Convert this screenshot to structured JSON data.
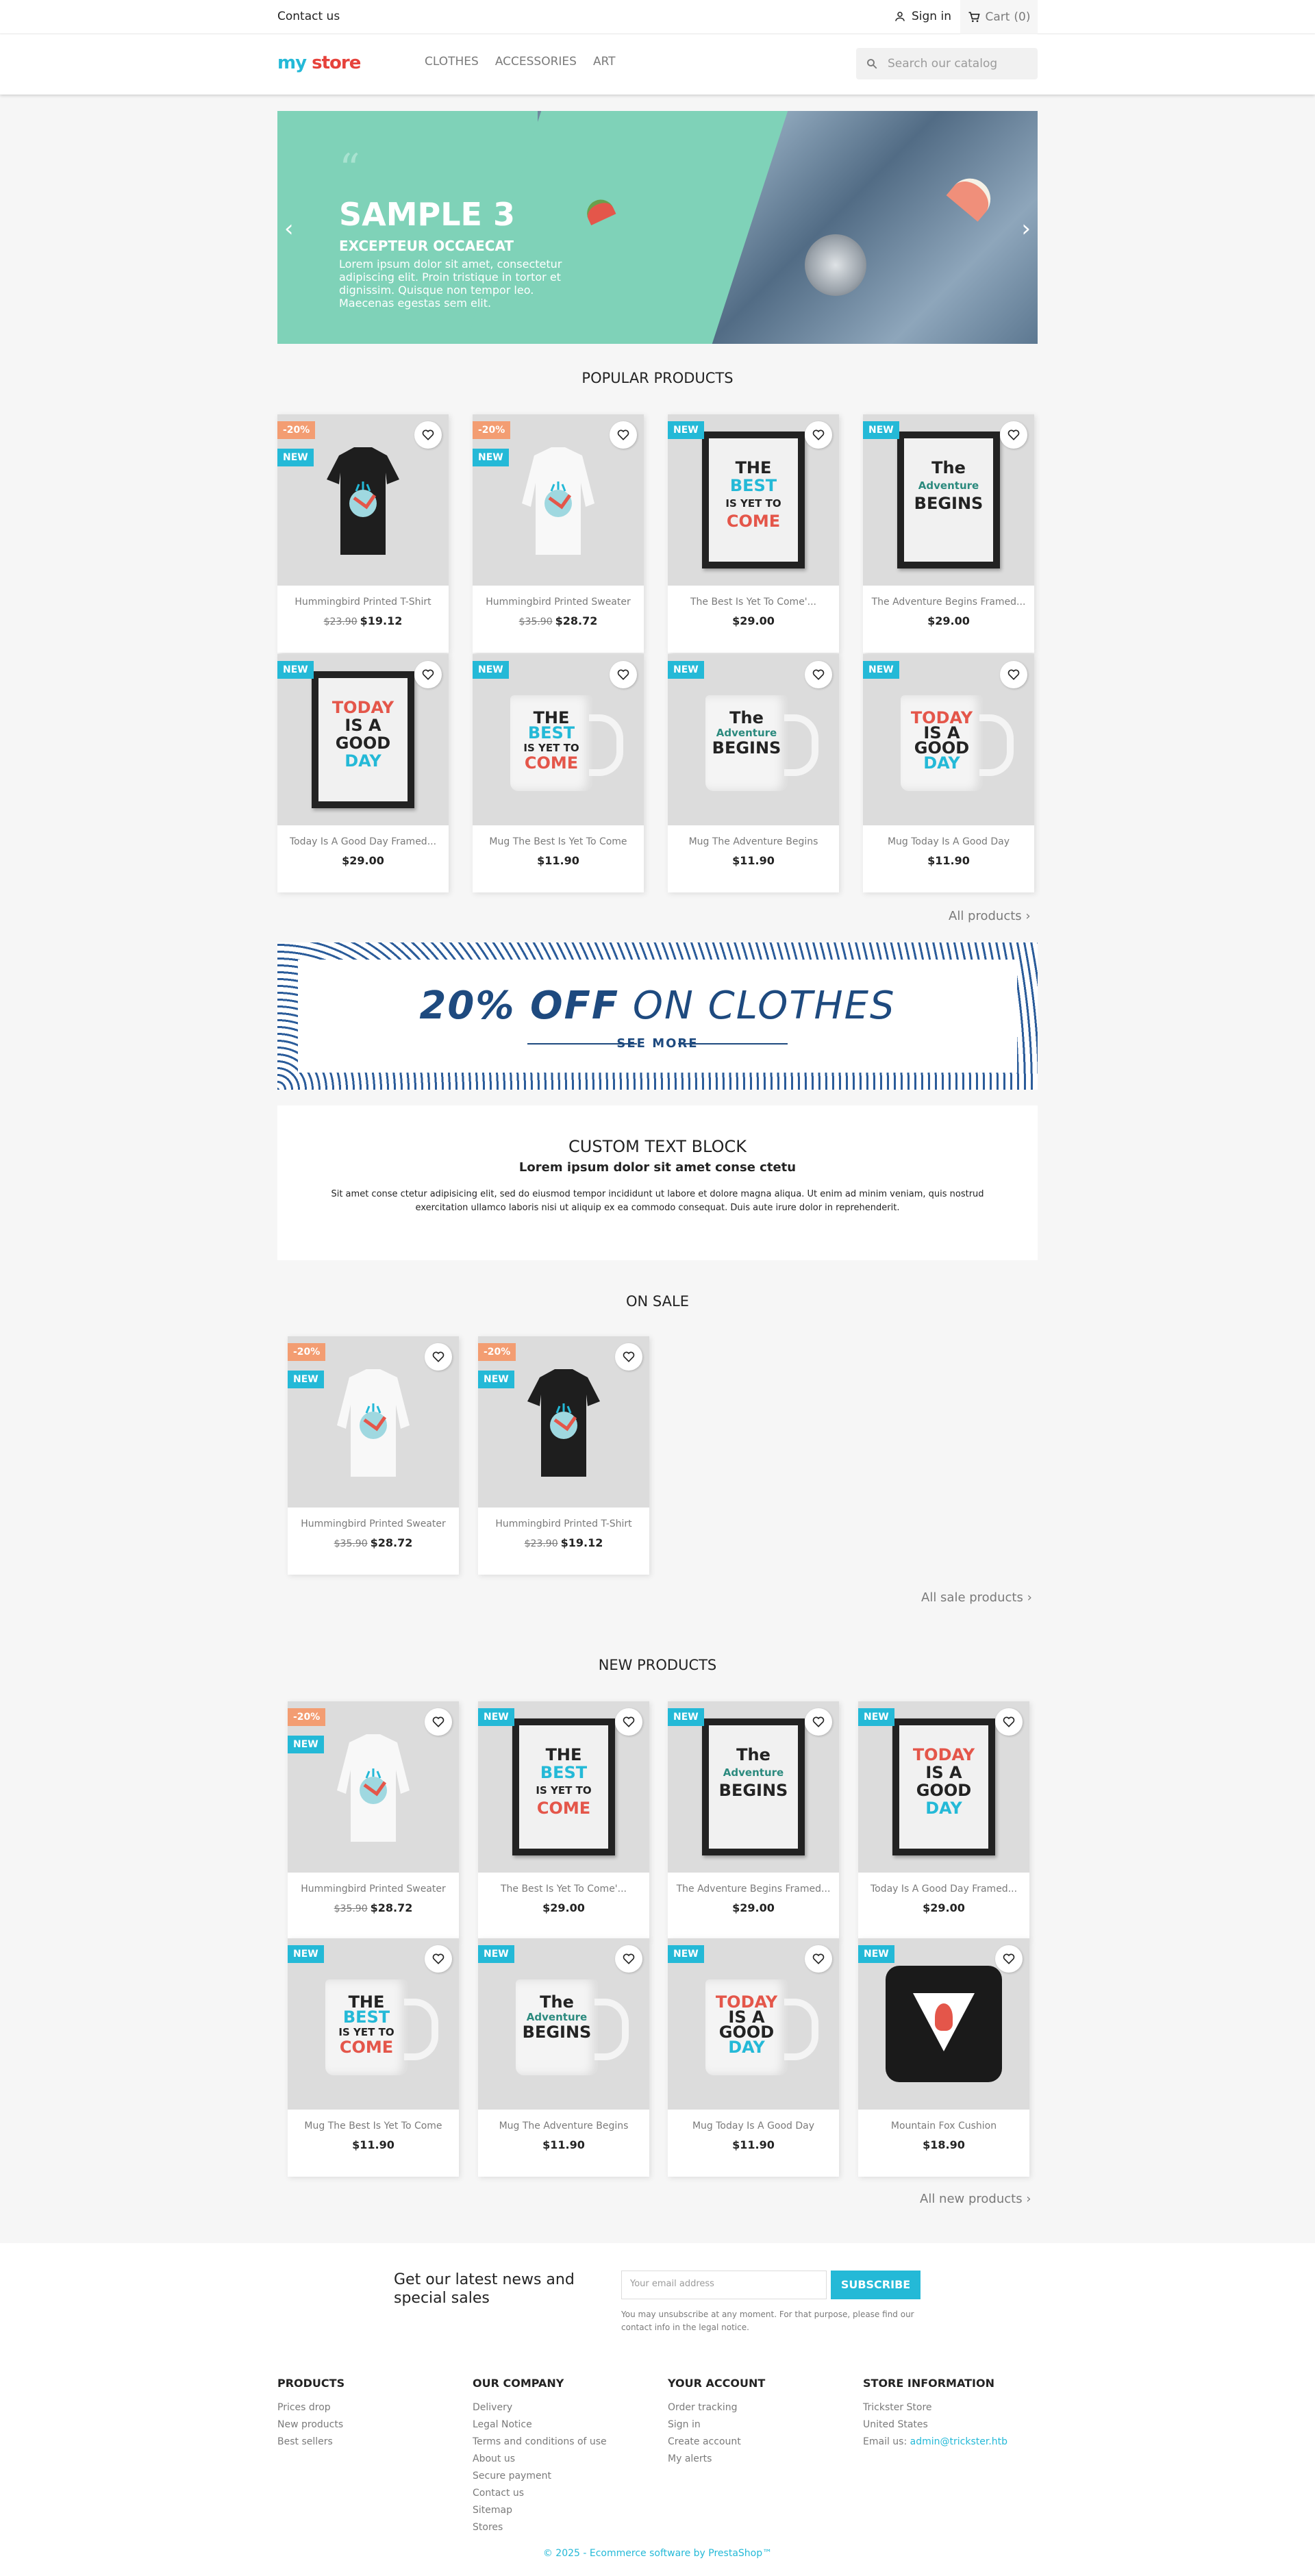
{
  "topbar": {
    "contact": "Contact us",
    "signin": "Sign in",
    "cart_label": "Cart",
    "cart_count": "(0)"
  },
  "header": {
    "logo_my": "my",
    "logo_store": "store",
    "nav": [
      "CLOTHES",
      "ACCESSORIES",
      "ART"
    ],
    "search_placeholder": "Search our catalog"
  },
  "slider": {
    "title": "SAMPLE 3",
    "subtitle": "EXCEPTEUR OCCAECAT",
    "description": "Lorem ipsum dolor sit amet, consectetur adipiscing elit. Proin tristique in tortor et dignissim. Quisque non tempor leo. Maecenas egestas sem elit."
  },
  "popular": {
    "title": "POPULAR PRODUCTS",
    "all_link": "All products",
    "products": [
      {
        "name": "Hummingbird Printed T-Shirt",
        "old_price": "$23.90",
        "price": "$19.12",
        "discount": "-20%",
        "new": "NEW"
      },
      {
        "name": "Hummingbird Printed Sweater",
        "old_price": "$35.90",
        "price": "$28.72",
        "discount": "-20%",
        "new": "NEW"
      },
      {
        "name": "The Best Is Yet To Come'...",
        "price": "$29.00",
        "new": "NEW"
      },
      {
        "name": "The Adventure Begins Framed...",
        "price": "$29.00",
        "new": "NEW"
      },
      {
        "name": "Today Is A Good Day Framed...",
        "price": "$29.00",
        "new": "NEW"
      },
      {
        "name": "Mug The Best Is Yet To Come",
        "price": "$11.90",
        "new": "NEW"
      },
      {
        "name": "Mug The Adventure Begins",
        "price": "$11.90",
        "new": "NEW"
      },
      {
        "name": "Mug Today Is A Good Day",
        "price": "$11.90",
        "new": "NEW"
      }
    ]
  },
  "banner": {
    "title_bold": "20% OFF",
    "title_rest": " ON CLOTHES",
    "cta": "SEE MORE"
  },
  "custom_block": {
    "title": "CUSTOM TEXT BLOCK",
    "subtitle": "Lorem ipsum dolor sit amet conse ctetu",
    "text": "Sit amet conse ctetur adipisicing elit, sed do eiusmod tempor incididunt ut labore et dolore magna aliqua. Ut enim ad minim veniam, quis nostrud exercitation ullamco laboris nisi ut aliquip ex ea commodo consequat. Duis aute irure dolor in reprehenderit."
  },
  "on_sale": {
    "title": "ON SALE",
    "all_link": "All sale products",
    "products": [
      {
        "name": "Hummingbird Printed Sweater",
        "old_price": "$35.90",
        "price": "$28.72",
        "discount": "-20%",
        "new": "NEW"
      },
      {
        "name": "Hummingbird Printed T-Shirt",
        "old_price": "$23.90",
        "price": "$19.12",
        "discount": "-20%",
        "new": "NEW"
      }
    ]
  },
  "new_products": {
    "title": "NEW PRODUCTS",
    "all_link": "All new products",
    "products": [
      {
        "name": "Hummingbird Printed Sweater",
        "old_price": "$35.90",
        "price": "$28.72",
        "discount": "-20%",
        "new": "NEW"
      },
      {
        "name": "The Best Is Yet To Come'...",
        "price": "$29.00",
        "new": "NEW"
      },
      {
        "name": "The Adventure Begins Framed...",
        "price": "$29.00",
        "new": "NEW"
      },
      {
        "name": "Today Is A Good Day Framed...",
        "price": "$29.00",
        "new": "NEW"
      },
      {
        "name": "Mug The Best Is Yet To Come",
        "price": "$11.90",
        "new": "NEW"
      },
      {
        "name": "Mug The Adventure Begins",
        "price": "$11.90",
        "new": "NEW"
      },
      {
        "name": "Mug Today Is A Good Day",
        "price": "$11.90",
        "new": "NEW"
      },
      {
        "name": "Mountain Fox Cushion",
        "price": "$18.90",
        "new": "NEW"
      }
    ]
  },
  "art_text": {
    "best": [
      "THE",
      "BEST",
      "IS YET TO",
      "COME"
    ],
    "adventure": [
      "The",
      "Adventure",
      "BEGINS"
    ],
    "today": [
      "TODAY",
      "IS A",
      "GOOD",
      "DAY"
    ]
  },
  "newsletter": {
    "text": "Get our latest news and special sales",
    "placeholder": "Your email address",
    "button": "SUBSCRIBE",
    "note": "You may unsubscribe at any moment. For that purpose, please find our contact info in the legal notice."
  },
  "footer": {
    "products": {
      "title": "PRODUCTS",
      "links": [
        "Prices drop",
        "New products",
        "Best sellers"
      ]
    },
    "company": {
      "title": "OUR COMPANY",
      "links": [
        "Delivery",
        "Legal Notice",
        "Terms and conditions of use",
        "About us",
        "Secure payment",
        "Contact us",
        "Sitemap",
        "Stores"
      ]
    },
    "account": {
      "title": "YOUR ACCOUNT",
      "links": [
        "Order tracking",
        "Sign in",
        "Create account",
        "My alerts"
      ]
    },
    "store": {
      "title": "STORE INFORMATION",
      "lines": [
        "Trickster Store",
        "United States"
      ],
      "email_label": "Email us:",
      "email": "admin@trickster.htb"
    },
    "copyright": "© 2025 - Ecommerce software by PrestaShop™"
  },
  "colors": {
    "accent": "#24b9d7",
    "discount": "#f39d72",
    "slider_bg": "#7fd2b8",
    "banner_blue": "#1e4a7f"
  }
}
